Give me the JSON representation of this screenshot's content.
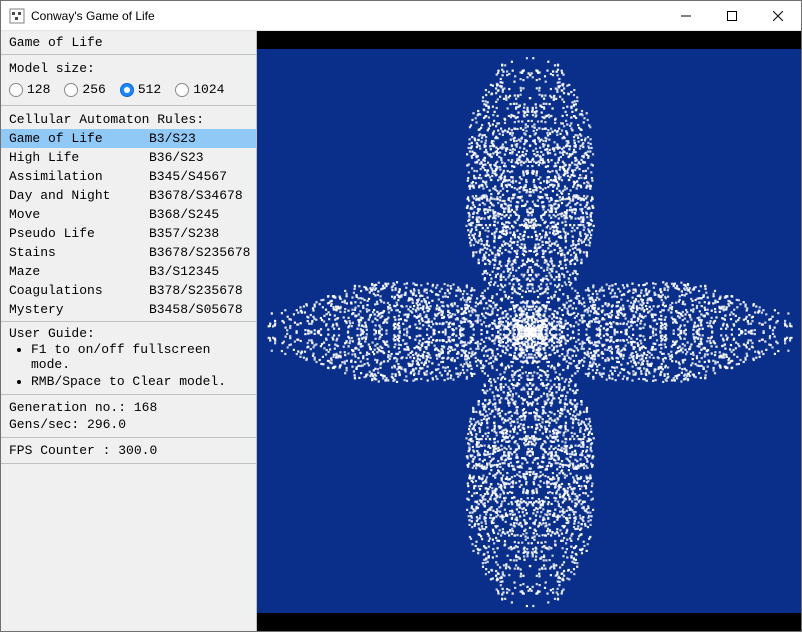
{
  "window": {
    "title": "Conway's Game of Life"
  },
  "sidebar": {
    "heading": "Game of Life",
    "model_size_label": "Model size:",
    "model_sizes": [
      {
        "label": "128",
        "selected": false
      },
      {
        "label": "256",
        "selected": false
      },
      {
        "label": "512",
        "selected": true
      },
      {
        "label": "1024",
        "selected": false
      }
    ],
    "rules_label": "Cellular Automaton Rules:",
    "rules": [
      {
        "name": "Game of Life",
        "code": "B3/S23",
        "selected": true
      },
      {
        "name": "High Life",
        "code": "B36/S23",
        "selected": false
      },
      {
        "name": "Assimilation",
        "code": "B345/S4567",
        "selected": false
      },
      {
        "name": "Day and Night",
        "code": "B3678/S34678",
        "selected": false
      },
      {
        "name": "Move",
        "code": "B368/S245",
        "selected": false
      },
      {
        "name": "Pseudo Life",
        "code": "B357/S238",
        "selected": false
      },
      {
        "name": "Stains",
        "code": "B3678/S235678",
        "selected": false
      },
      {
        "name": "Maze",
        "code": "B3/S12345",
        "selected": false
      },
      {
        "name": "Coagulations",
        "code": "B378/S235678",
        "selected": false
      },
      {
        "name": "Mystery",
        "code": "B3458/S05678",
        "selected": false
      }
    ],
    "guide_label": "User Guide:",
    "guide_items": [
      "F1 to on/off fullscreen mode.",
      "RMB/Space to Clear model."
    ],
    "stats": {
      "generation_label": "Generation no.:",
      "generation_value": "168",
      "gens_sec_label": "Gens/sec:",
      "gens_sec_value": "296.0",
      "fps_label": "FPS Counter :",
      "fps_value": "300.0"
    }
  },
  "sim": {
    "bg_color": "#0a2f8a",
    "cell_color": "#ffffff"
  }
}
